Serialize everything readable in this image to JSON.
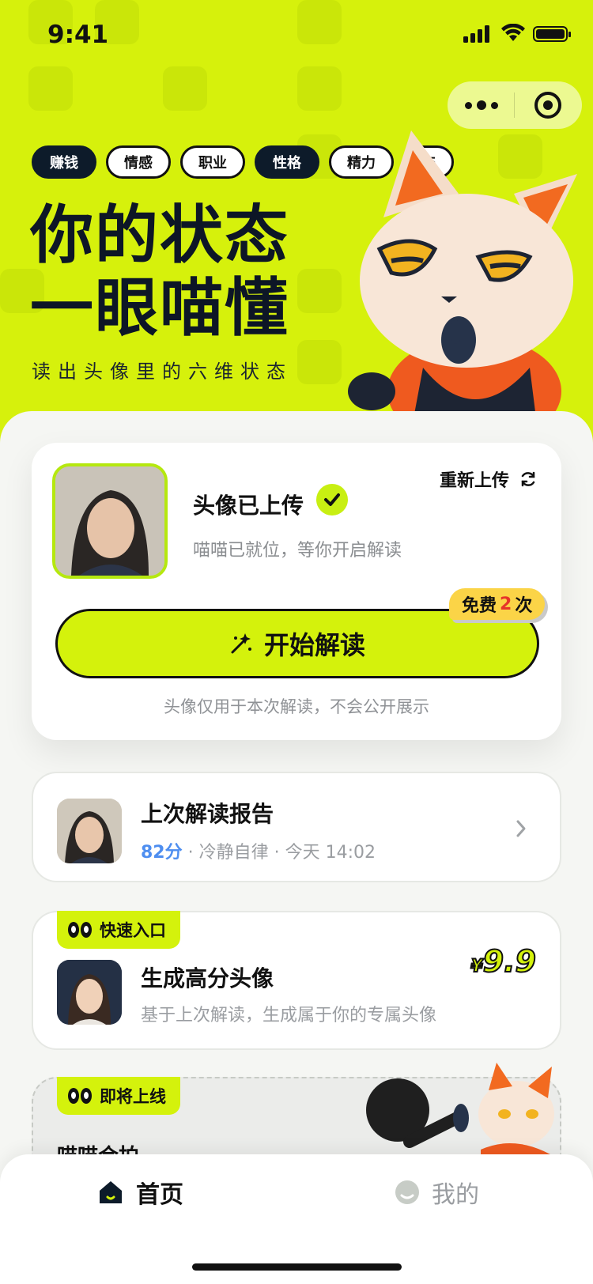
{
  "status_bar": {
    "time": "9:41"
  },
  "hero": {
    "tags": [
      "赚钱",
      "情感",
      "职业",
      "性格",
      "精力",
      "交"
    ],
    "headline_line1": "你的状态",
    "headline_line2": "一眼喵懂",
    "subtitle": "读出头像里的六维状态"
  },
  "upload_card": {
    "status": "头像已上传",
    "reupload_label": "重新上传",
    "ready_text": "喵喵已就位，等你开启解读",
    "start_button": "开始解读",
    "free_badge_prefix": "免费",
    "free_badge_count": "2",
    "free_badge_suffix": "次",
    "privacy_note": "头像仅用于本次解读，不会公开展示"
  },
  "report_card": {
    "title": "上次解读报告",
    "score": "82分",
    "meta": " · 冷静自律 · 今天 14:02"
  },
  "generate_card": {
    "label": "快速入口",
    "title": "生成高分头像",
    "desc": "基于上次解读，生成属于你的专属头像",
    "price_symbol": "¥",
    "price": "9.9"
  },
  "soon_card": {
    "label": "即将上线",
    "title": "喵喵合拍"
  },
  "tabbar": {
    "home": "首页",
    "mine": "我的"
  },
  "colors": {
    "accent": "#d4f20c",
    "dark": "#0d1b2a",
    "score_blue": "#4e8ef0",
    "badge_yellow": "#fbd447"
  }
}
